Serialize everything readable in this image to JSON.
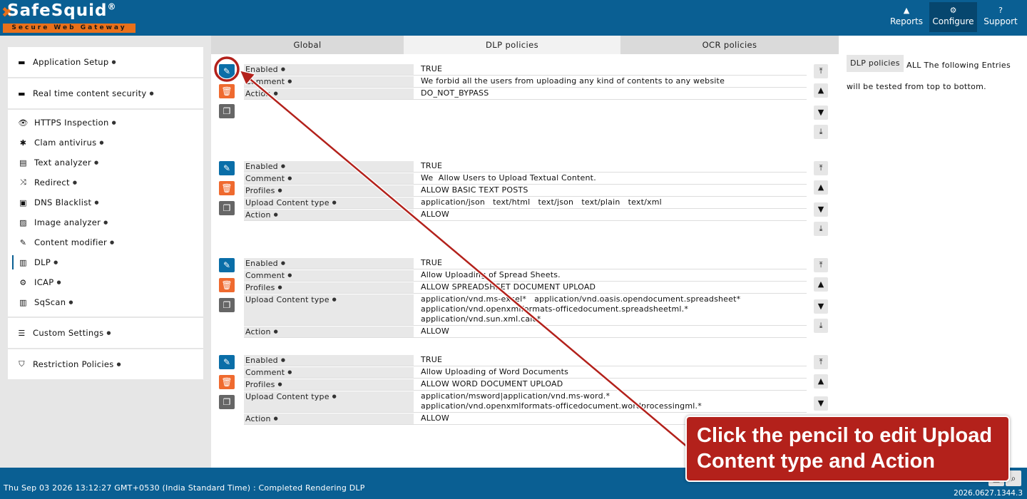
{
  "brand": {
    "name": "SafeSquid",
    "mark": "®",
    "tagline": "Secure Web Gateway"
  },
  "nav": [
    {
      "label": "Reports",
      "icon": "chart-icon"
    },
    {
      "label": "Configure",
      "icon": "cogs-icon",
      "active": true
    },
    {
      "label": "Support",
      "icon": "question-icon"
    }
  ],
  "sidebar": {
    "groups": [
      {
        "label": "Application Setup",
        "icon": "briefcase-icon"
      },
      {
        "label": "Real time content security",
        "icon": "briefcase-icon"
      }
    ],
    "items": [
      {
        "label": "HTTPS Inspection",
        "icon": "eye-icon"
      },
      {
        "label": "Clam antivirus",
        "icon": "asterisk-icon"
      },
      {
        "label": "Text analyzer",
        "icon": "file-text-icon"
      },
      {
        "label": "Redirect",
        "icon": "shuffle-icon"
      },
      {
        "label": "DNS Blacklist",
        "icon": "dns-icon"
      },
      {
        "label": "Image analyzer",
        "icon": "image-icon"
      },
      {
        "label": "Content modifier",
        "icon": "edit-icon"
      },
      {
        "label": "DLP",
        "icon": "barcode-icon",
        "active": true
      },
      {
        "label": "ICAP",
        "icon": "gear-icon"
      },
      {
        "label": "SqScan",
        "icon": "barcode-icon"
      }
    ],
    "bottom": [
      {
        "label": "Custom Settings",
        "icon": "sliders-icon"
      },
      {
        "label": "Restriction Policies",
        "icon": "shield-icon"
      }
    ]
  },
  "tabs": [
    {
      "label": "Global"
    },
    {
      "label": "DLP policies",
      "active": true
    },
    {
      "label": "OCR policies"
    }
  ],
  "entries": [
    {
      "rows": [
        {
          "label": "Enabled",
          "value": "TRUE"
        },
        {
          "label": "Comment",
          "value": "We forbid all the users from uploading any kind of contents to any website"
        },
        {
          "label": "Action",
          "value": "DO_NOT_BYPASS"
        }
      ]
    },
    {
      "rows": [
        {
          "label": "Enabled",
          "value": "TRUE"
        },
        {
          "label": "Comment",
          "value": "We  Allow Users to Upload Textual Content."
        },
        {
          "label": "Profiles",
          "value": "ALLOW BASIC TEXT POSTS"
        },
        {
          "label": "Upload Content type",
          "value": "application/json   text/html   text/json   text/plain   text/xml"
        },
        {
          "label": "Action",
          "value": "ALLOW"
        }
      ]
    },
    {
      "rows": [
        {
          "label": "Enabled",
          "value": "TRUE"
        },
        {
          "label": "Comment",
          "value": "Allow Uploading of Spread Sheets."
        },
        {
          "label": "Profiles",
          "value": "ALLOW SPREADSHEET DOCUMENT UPLOAD"
        },
        {
          "label": "Upload Content type",
          "value": "application/vnd.ms-excel*   application/vnd.oasis.opendocument.spreadsheet*\napplication/vnd.openxmlformats-officedocument.spreadsheetml.*\napplication/vnd.sun.xml.calc*"
        },
        {
          "label": "Action",
          "value": "ALLOW"
        }
      ]
    },
    {
      "rows": [
        {
          "label": "Enabled",
          "value": "TRUE"
        },
        {
          "label": "Comment",
          "value": "Allow Uploading of Word Documents"
        },
        {
          "label": "Profiles",
          "value": "ALLOW WORD DOCUMENT UPLOAD"
        },
        {
          "label": "Upload Content type",
          "value": "application/msword|application/vnd.ms-word.*\napplication/vnd.openxmlformats-officedocument.wordprocessingml.*"
        },
        {
          "label": "Action",
          "value": "ALLOW"
        }
      ]
    }
  ],
  "right_panel": {
    "tag": "DLP policies",
    "text": "ALL The following Entries will be tested from top to bottom."
  },
  "status": {
    "text": "Thu Sep 03 2026 13:12:27 GMT+0530 (India Standard Time) : Completed Rendering DLP",
    "version": "2026.0627.1344.3"
  },
  "callout": {
    "text": "Click the pencil to edit Upload Content type and Action"
  },
  "colors": {
    "header": "#0a5f93",
    "accent_orange": "#ef6a2f",
    "callout": "#b3211b",
    "annotation": "#b3211b"
  }
}
